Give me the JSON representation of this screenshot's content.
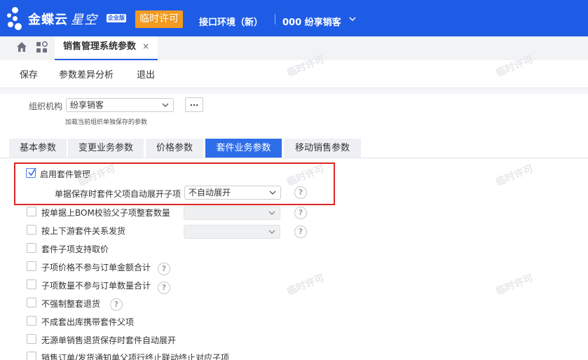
{
  "header": {
    "brand_main": "金蝶云",
    "brand_sub": "星空",
    "edition_badge": "企业版",
    "license_badge": "临时许可",
    "environment": "接口环境（新）",
    "organization": "000 纷享销客",
    "colors": {
      "bar": "#1f5ce6",
      "license": "#f39a1f"
    }
  },
  "tabbar": {
    "home_icon": "home-icon",
    "apps_icon": "grid-icon",
    "doc_tab": {
      "label": "销售管理系统参数",
      "close": "×"
    }
  },
  "toolbar": {
    "save_label": "保存",
    "diff_label": "参数差异分析",
    "exit_label": "退出"
  },
  "org_row": {
    "label": "组织机构",
    "value": "纷享销客",
    "more_label": "...",
    "hint": "加载当前组织单独保存的参数"
  },
  "param_tabs": [
    {
      "label": "基本参数",
      "active": false
    },
    {
      "label": "变更业务参数",
      "active": false
    },
    {
      "label": "价格参数",
      "active": false
    },
    {
      "label": "套件业务参数",
      "active": true
    },
    {
      "label": "移动销售参数",
      "active": false
    }
  ],
  "options": {
    "enable_kit": {
      "label": "启用套件管理",
      "checked": true
    },
    "auto_expand": {
      "label": "单据保存时套件父项自动展开子项",
      "value": "不自动展开"
    },
    "bom_check": {
      "label": "按单据上BOM校验父子项整套数量",
      "checked": false,
      "value": ""
    },
    "ship_by_relation": {
      "label": "按上下游套件关系发货",
      "checked": false,
      "value": ""
    },
    "child_price": {
      "label": "套件子项支持取价",
      "checked": false
    },
    "price_excluded": {
      "label": "子项价格不参与订单金额合计",
      "checked": false
    },
    "qty_excluded": {
      "label": "子项数量不参与订单数量合计",
      "checked": false
    },
    "no_force_return": {
      "label": "不强制整套退货",
      "checked": false
    },
    "no_carry_parent": {
      "label": "不成套出库携带套件父项",
      "checked": false
    },
    "unsourced_return": {
      "label": "无源单销售退货保存时套件自动展开",
      "checked": false
    },
    "linked_close": {
      "label": "销售订单/发货通知单父项行终止联动终止对应子项",
      "checked": false
    }
  },
  "help_glyph": "?",
  "watermark": "临时许可"
}
